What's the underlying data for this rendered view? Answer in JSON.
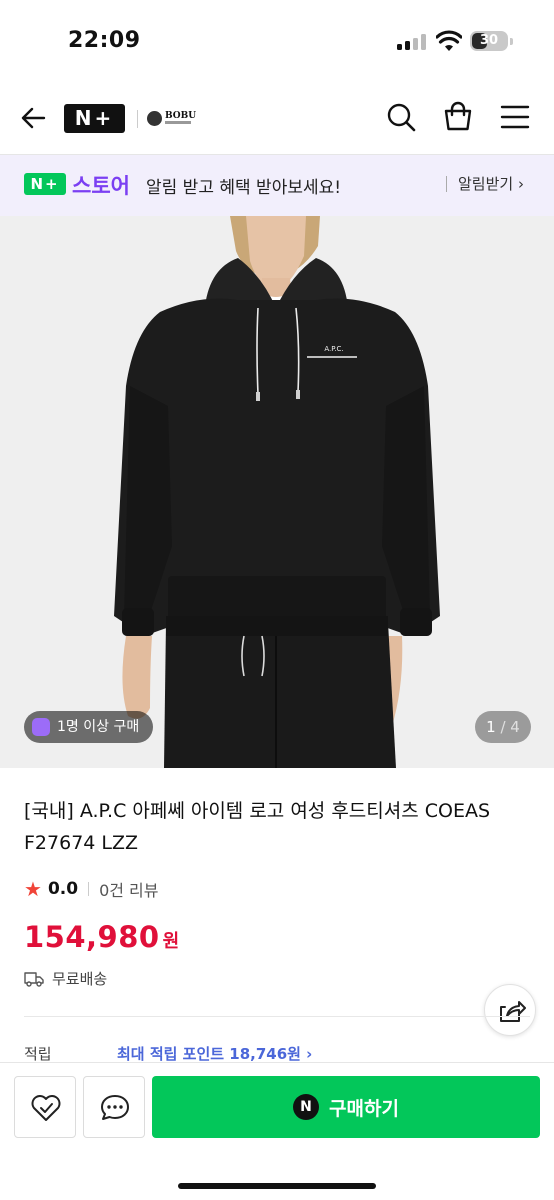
{
  "status_bar": {
    "time": "22:09",
    "battery": "30"
  },
  "header": {
    "logo": "N+",
    "brand": "BOBU"
  },
  "banner": {
    "logo": "N+",
    "store": "스토어",
    "message": "알림 받고 혜택 받아보세요!",
    "action": "알림받기 ›"
  },
  "gallery": {
    "buyer_badge": "1명 이상 구매",
    "current_page": "1",
    "total_pages": "/ 4",
    "garment_print": "A.P.C."
  },
  "product": {
    "title": "[국내] A.P.C 아페쎄 아이템 로고 여성 후드티셔츠 COEAS F27674 LZZ",
    "rating": "0.0",
    "review_count": "0건 리뷰",
    "price": "154,980",
    "currency": "원",
    "shipping": "무료배송",
    "points_label": "적립",
    "points_value": "최대 적립 포인트 18,746원 ›"
  },
  "bottom_bar": {
    "buy_label": "구매하기",
    "n_logo": "N"
  },
  "colors": {
    "naver_green": "#03c75a",
    "store_purple": "#7b3ff2",
    "price_red": "#e0103a",
    "points_blue": "#4b67d9"
  }
}
